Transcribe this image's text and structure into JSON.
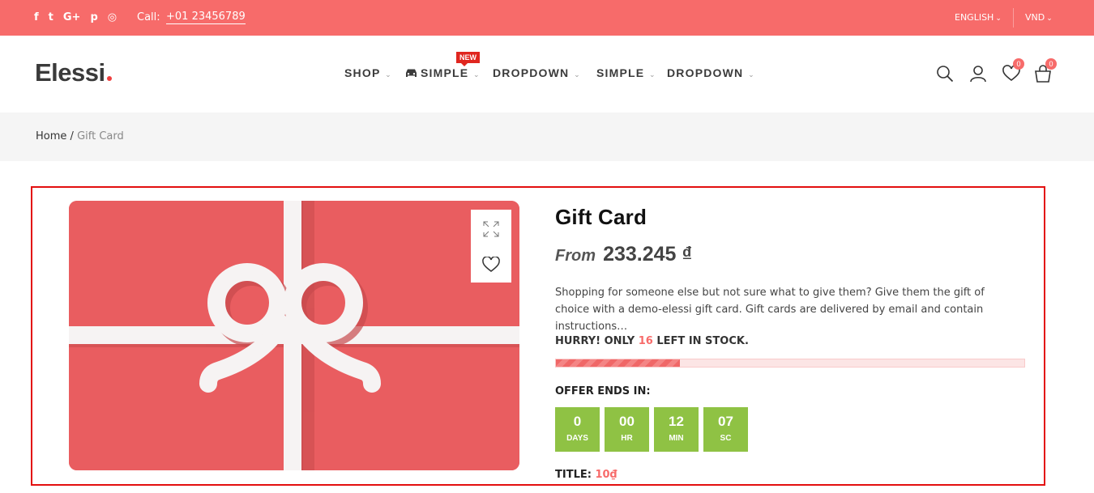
{
  "topbar": {
    "social_icons": [
      "facebook-icon",
      "twitter-icon",
      "google-plus-icon",
      "pinterest-icon",
      "instagram-icon"
    ],
    "social_glyphs": [
      "f",
      "t",
      "G+",
      "p",
      "◎"
    ],
    "call_label": "Call:",
    "phone": "+01 23456789",
    "language": "ENGLISH",
    "currency": "VND",
    "background_color": "#f76b6a"
  },
  "header": {
    "logo": "Elessi",
    "nav": [
      {
        "label": "SHOP"
      },
      {
        "label": "SIMPLE",
        "badge": "NEW",
        "icon": "car-icon"
      },
      {
        "label": "DROPDOWN"
      },
      {
        "label": "SIMPLE"
      },
      {
        "label": "DROPDOWN"
      }
    ],
    "wishlist_count": "0",
    "cart_count": "0"
  },
  "breadcrumb": {
    "home": "Home",
    "separator": "/",
    "current": "Gift Card"
  },
  "product": {
    "title": "Gift Card",
    "price_prefix": "From",
    "price": "233.245 ₫",
    "description": "Shopping for someone else but not sure what to give them? Give them the gift of choice with a demo-elessi gift card. Gift cards are delivered by email and contain instructions…",
    "stock_prefix": "HURRY! ONLY",
    "stock_count": "16",
    "stock_suffix": "LEFT IN STOCK.",
    "stock_progress_fraction": 0.265,
    "offer_label": "OFFER ENDS IN:",
    "countdown": [
      {
        "value": "0",
        "unit": "DAYS"
      },
      {
        "value": "00",
        "unit": "HR"
      },
      {
        "value": "12",
        "unit": "MIN"
      },
      {
        "value": "07",
        "unit": "SC"
      }
    ],
    "title_label": "TITLE:",
    "title_value": "10₫",
    "accent_color": "#f76b6a",
    "countdown_color": "#8fc244"
  }
}
